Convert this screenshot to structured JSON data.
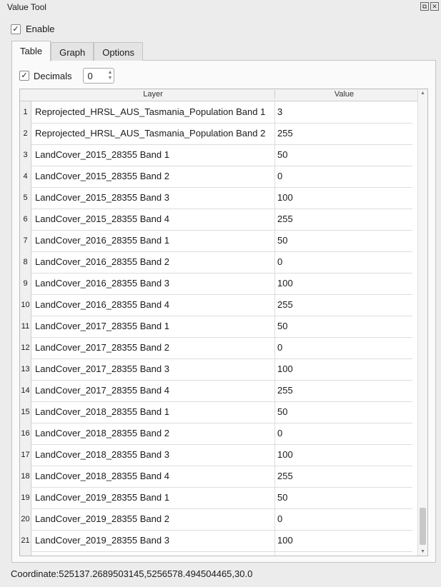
{
  "title": "Value Tool",
  "enable": {
    "label": "Enable",
    "checked": true
  },
  "tabs": [
    {
      "label": "Table"
    },
    {
      "label": "Graph"
    },
    {
      "label": "Options"
    }
  ],
  "decimals": {
    "label": "Decimals",
    "checked": true,
    "value": "0"
  },
  "table": {
    "headers": [
      "Layer",
      "Value"
    ],
    "rows": [
      [
        "1",
        "Reprojected_HRSL_AUS_Tasmania_Population Band 1",
        "3"
      ],
      [
        "2",
        "Reprojected_HRSL_AUS_Tasmania_Population Band 2",
        "255"
      ],
      [
        "3",
        "LandCover_2015_28355 Band 1",
        "50"
      ],
      [
        "4",
        "LandCover_2015_28355 Band 2",
        "0"
      ],
      [
        "5",
        "LandCover_2015_28355 Band 3",
        "100"
      ],
      [
        "6",
        "LandCover_2015_28355 Band 4",
        "255"
      ],
      [
        "7",
        "LandCover_2016_28355 Band 1",
        "50"
      ],
      [
        "8",
        "LandCover_2016_28355 Band 2",
        "0"
      ],
      [
        "9",
        "LandCover_2016_28355 Band 3",
        "100"
      ],
      [
        "10",
        "LandCover_2016_28355 Band 4",
        "255"
      ],
      [
        "11",
        "LandCover_2017_28355 Band 1",
        "50"
      ],
      [
        "12",
        "LandCover_2017_28355 Band 2",
        "0"
      ],
      [
        "13",
        "LandCover_2017_28355 Band 3",
        "100"
      ],
      [
        "14",
        "LandCover_2017_28355 Band 4",
        "255"
      ],
      [
        "15",
        "LandCover_2018_28355 Band 1",
        "50"
      ],
      [
        "16",
        "LandCover_2018_28355 Band 2",
        "0"
      ],
      [
        "17",
        "LandCover_2018_28355 Band 3",
        "100"
      ],
      [
        "18",
        "LandCover_2018_28355 Band 4",
        "255"
      ],
      [
        "19",
        "LandCover_2019_28355 Band 1",
        "50"
      ],
      [
        "20",
        "LandCover_2019_28355 Band 2",
        "0"
      ],
      [
        "21",
        "LandCover_2019_28355 Band 3",
        "100"
      ]
    ]
  },
  "coordinate": "Coordinate:525137.2689503145,5256578.494504465,30.0"
}
